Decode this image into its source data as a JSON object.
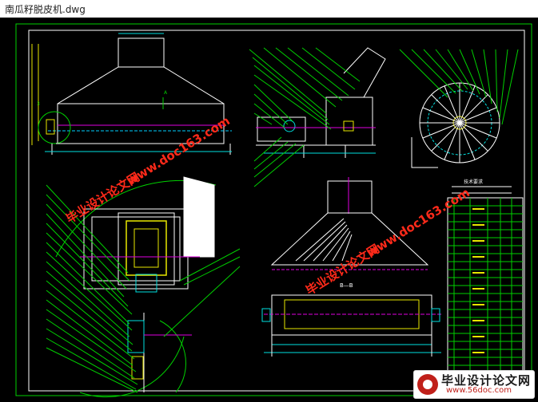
{
  "window": {
    "title": "南瓜籽脱皮机.dwg"
  },
  "watermarks": {
    "site_cn": "毕业设计论文网",
    "site_url": "www.doc163.com",
    "color": "#ff2a1a"
  },
  "branding": {
    "name": "毕业设计论文网",
    "url": "www.56doc.com"
  },
  "drawing": {
    "section_label": "B—B",
    "label_a": "A",
    "label_3": "3",
    "line_color": "#ffffff",
    "frame_color": "#00d000",
    "accent_yellow": "#e8e800",
    "accent_cyan": "#00e0e0",
    "accent_magenta": "#e000e0"
  },
  "tech_requirements": {
    "heading": "技术要求"
  }
}
